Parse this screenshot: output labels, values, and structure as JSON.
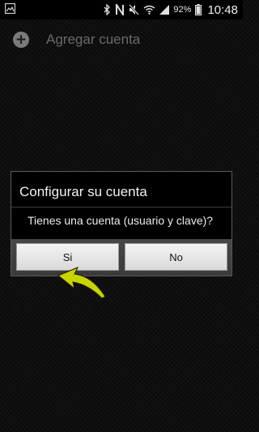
{
  "status_bar": {
    "battery_percent": "92%",
    "time": "10:48",
    "left_icon": "image-notification-icon",
    "icons": [
      "bluetooth-icon",
      "nfc-icon",
      "mute-icon",
      "wifi-icon",
      "signal-icon",
      "battery-icon"
    ]
  },
  "account_list": {
    "add_label": "Agregar cuenta",
    "add_icon": "plus-circle-icon"
  },
  "dialog": {
    "title": "Configurar su cuenta",
    "message": "Tienes una cuenta (usuario y clave)?",
    "yes_label": "Si",
    "no_label": "No"
  },
  "annotation": {
    "arrow_color": "#c7d400",
    "arrow_icon": "curved-arrow-icon"
  }
}
